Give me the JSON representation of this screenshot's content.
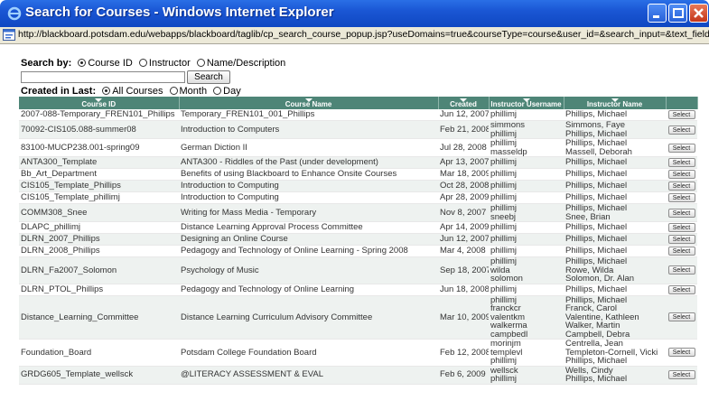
{
  "window": {
    "title": "Search for Courses - Windows Internet Explorer",
    "url": "http://blackboard.potsdam.edu/webapps/blackboard/taglib/cp_search_course_popup.jsp?useDomains=true&courseType=course&user_id=&search_input=&text_field=window.opener.docun"
  },
  "search": {
    "search_by_label": "Search by:",
    "options": [
      "Course ID",
      "Instructor",
      "Name/Description"
    ],
    "selected": 0,
    "input_value": "",
    "button_label": "Search",
    "created_in_last_label": "Created in Last:",
    "created_options": [
      "All Courses",
      "Month",
      "Day"
    ],
    "created_selected": 0
  },
  "table": {
    "columns": [
      "Course ID",
      "Course Name",
      "Created",
      "Instructor Username",
      "Instructor Name",
      ""
    ],
    "select_label": "Select",
    "rows": [
      {
        "id": "2007-088-Temporary_FREN101_Phillips",
        "name": "Temporary_FREN101_001_Phillips",
        "created": "Jun 12, 2007",
        "user": "phillimj",
        "inst": "Phillips, Michael"
      },
      {
        "id": "70092-CIS105.088-summer08",
        "name": "Introduction to Computers",
        "created": "Feb 21, 2008",
        "user": "simmons\nphillimj",
        "inst": "Simmons, Faye\nPhillips, Michael"
      },
      {
        "id": "83100-MUCP238.001-spring09",
        "name": "German Diction II",
        "created": "Jul 28, 2008",
        "user": "phillimj\nmasseldp",
        "inst": "Phillips, Michael\nMassell, Deborah"
      },
      {
        "id": "ANTA300_Template",
        "name": "ANTA300 - Riddles of the Past (under development)",
        "created": "Apr 13, 2007",
        "user": "phillimj",
        "inst": "Phillips, Michael"
      },
      {
        "id": "Bb_Art_Department",
        "name": "Benefits of using Blackboard to Enhance Onsite Courses",
        "created": "Mar 18, 2009",
        "user": "phillimj",
        "inst": "Phillips, Michael"
      },
      {
        "id": "CIS105_Template_Phillips",
        "name": "Introduction to Computing",
        "created": "Oct 28, 2008",
        "user": "phillimj",
        "inst": "Phillips, Michael"
      },
      {
        "id": "CIS105_Template_phillimj",
        "name": "Introduction to Computing",
        "created": "Apr 28, 2009",
        "user": "phillimj",
        "inst": "Phillips, Michael"
      },
      {
        "id": "COMM308_Snee",
        "name": "Writing for Mass Media - Temporary",
        "created": "Nov 8, 2007",
        "user": "phillimj\nsneebj",
        "inst": "Phillips, Michael\nSnee, Brian"
      },
      {
        "id": "DLAPC_phillimj",
        "name": "Distance Learning Approval Process Committee",
        "created": "Apr 14, 2009",
        "user": "phillimj",
        "inst": "Phillips, Michael"
      },
      {
        "id": "DLRN_2007_Phillips",
        "name": "Designing an Online Course",
        "created": "Jun 12, 2007",
        "user": "phillimj",
        "inst": "Phillips, Michael"
      },
      {
        "id": "DLRN_2008_Phillips",
        "name": "Pedagogy and Technology of Online Learning - Spring 2008",
        "created": "Mar 4, 2008",
        "user": "phillimj",
        "inst": "Phillips, Michael"
      },
      {
        "id": "DLRN_Fa2007_Solomon",
        "name": "Psychology of Music",
        "created": "Sep 18, 2007",
        "user": "phillimj\nwilda\nsolomon",
        "inst": "Phillips, Michael\nRowe, Wilda\nSolomon, Dr. Alan"
      },
      {
        "id": "DLRN_PTOL_Phillips",
        "name": "Pedagogy and Technology of Online Learning",
        "created": "Jun 18, 2008",
        "user": "phillimj",
        "inst": "Phillips, Michael"
      },
      {
        "id": "Distance_Learning_Committee",
        "name": "Distance Learning Curriculum Advisory Committee",
        "created": "Mar 10, 2009",
        "user": "phillimj\nfranckcr\nvalentkm\nwalkerma\ncampbedl",
        "inst": "Phillips, Michael\nFranck, Carol\nValentine, Kathleen\nWalker, Martin\nCampbell, Debra"
      },
      {
        "id": "Foundation_Board",
        "name": "Potsdam College Foundation Board",
        "created": "Feb 12, 2008",
        "user": "morinjm\ntemplevl\nphillimj",
        "inst": "Centrella, Jean\nTempleton-Cornell, Vicki\nPhillips, Michael"
      },
      {
        "id": "GRDG605_Template_wellsck",
        "name": "@LITERACY ASSESSMENT & EVAL",
        "created": "Feb 6, 2009",
        "user": "wellsck\nphillimj",
        "inst": "Wells, Cindy\nPhillips, Michael"
      }
    ]
  }
}
